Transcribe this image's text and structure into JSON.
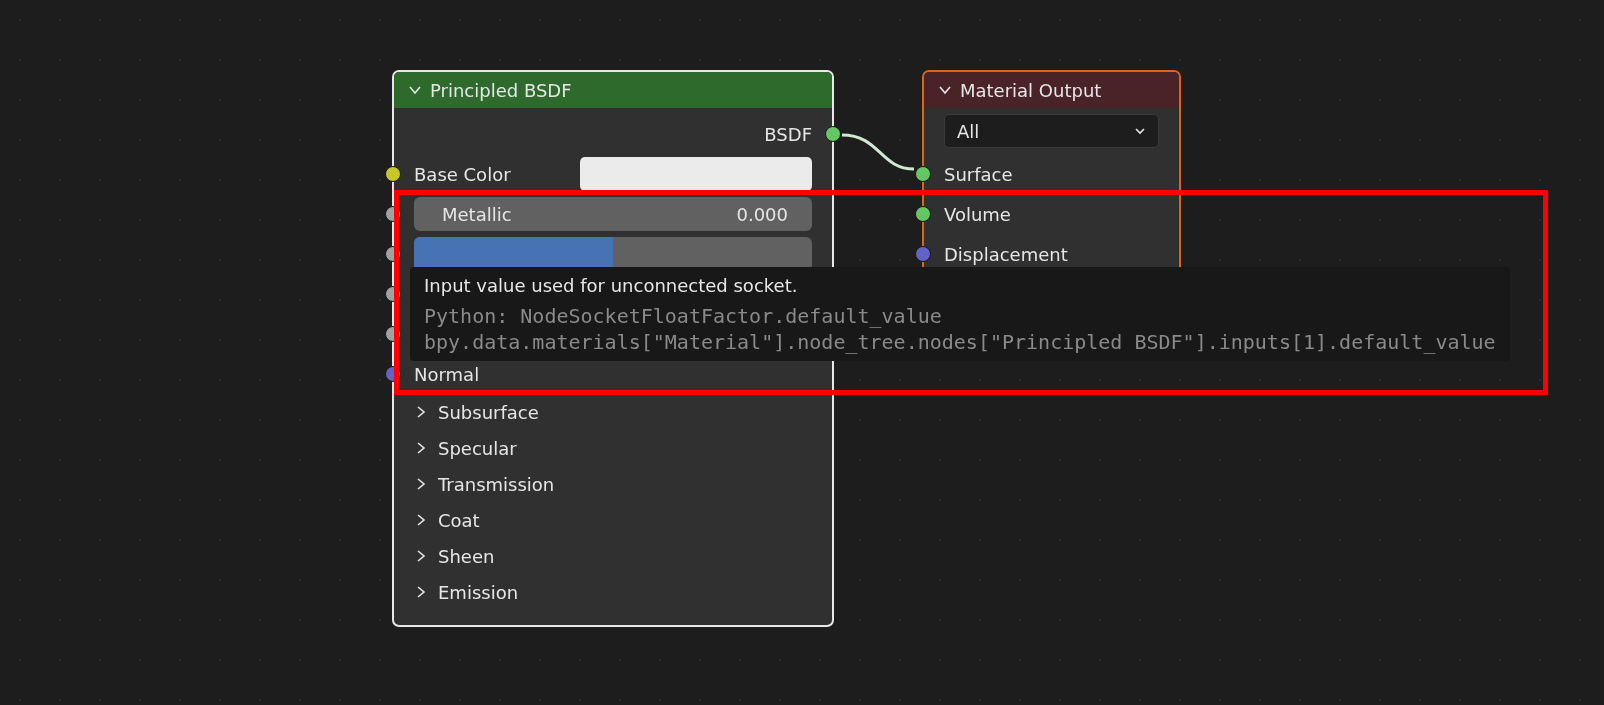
{
  "nodes": [
    {
      "kind": "shader",
      "title": "Principled BSDF",
      "expanded": true,
      "outputs": [
        {
          "label": "BSDF",
          "color": "#63c763"
        }
      ],
      "inputs": [
        {
          "kind": "color",
          "label": "Base Color",
          "color": "#c7c729"
        },
        {
          "kind": "slider",
          "label": "Metallic",
          "value": "0.000",
          "level": 0,
          "color": "#a1a1a1"
        },
        {
          "kind": "slider",
          "level": 0.5,
          "color": "#a1a1a1"
        },
        {
          "kind": "hidden",
          "color": "#a1a1a1"
        },
        {
          "kind": "hidden",
          "color": "#a1a1a1"
        },
        {
          "kind": "plain",
          "label": "Normal",
          "color": "#6363c7"
        }
      ],
      "panels": [
        {
          "label": "Subsurface",
          "expanded": false
        },
        {
          "label": "Specular",
          "expanded": false
        },
        {
          "label": "Transmission",
          "expanded": false
        },
        {
          "label": "Coat",
          "expanded": false
        },
        {
          "label": "Sheen",
          "expanded": false
        },
        {
          "label": "Emission",
          "expanded": false
        }
      ]
    },
    {
      "kind": "output",
      "title": "Material Output",
      "expanded": true,
      "target": "All",
      "inputs": [
        {
          "kind": "plain",
          "label": "Surface",
          "color": "#63c763"
        },
        {
          "kind": "plain",
          "label": "Volume",
          "color": "#63c763"
        },
        {
          "kind": "plain",
          "label": "Displacement",
          "color": "#6363c7"
        }
      ]
    }
  ],
  "tooltip": {
    "description": "Input value used for unconnected socket.",
    "python": [
      "Python: NodeSocketFloatFactor.default_value",
      "bpy.data.materials[\"Material\"].node_tree.nodes[\"Principled BSDF\"].inputs[1].default_value"
    ]
  },
  "annotation": {
    "kind": "rectangle"
  }
}
